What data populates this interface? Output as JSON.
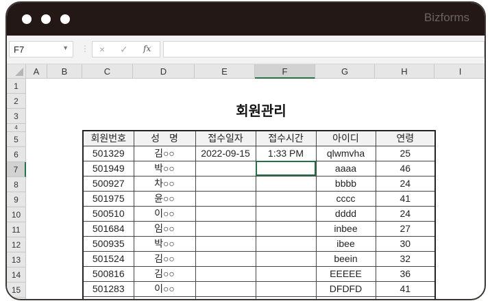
{
  "window": {
    "brand": "Bizforms"
  },
  "toolbar": {
    "name_box": "F7",
    "cancel_icon": "×",
    "enter_icon": "✓",
    "function_icon": "fx",
    "formula": ""
  },
  "columns": [
    "A",
    "B",
    "C",
    "D",
    "E",
    "F",
    "G",
    "H",
    "I"
  ],
  "rows": [
    "1",
    "2",
    "3",
    "4",
    "5",
    "6",
    "7",
    "8",
    "9",
    "10",
    "11",
    "12",
    "13",
    "14",
    "15"
  ],
  "sheet": {
    "title": "회원관리",
    "headers": [
      "회원번호",
      "성　명",
      "접수일자",
      "접수시간",
      "아이디",
      "연령"
    ],
    "records": [
      [
        "501329",
        "김○○",
        "2022-09-15",
        "1:33 PM",
        "qlwmvha",
        "25"
      ],
      [
        "501949",
        "박○○",
        "",
        "",
        "aaaa",
        "46"
      ],
      [
        "500927",
        "차○○",
        "",
        "",
        "bbbb",
        "24"
      ],
      [
        "501975",
        "윤○○",
        "",
        "",
        "cccc",
        "41"
      ],
      [
        "500510",
        "이○○",
        "",
        "",
        "dddd",
        "24"
      ],
      [
        "501684",
        "임○○",
        "",
        "",
        "inbee",
        "27"
      ],
      [
        "500935",
        "박○○",
        "",
        "",
        "ibee",
        "30"
      ],
      [
        "501524",
        "김○○",
        "",
        "",
        "beein",
        "32"
      ],
      [
        "500816",
        "김○○",
        "",
        "",
        "EEEEE",
        "36"
      ],
      [
        "501283",
        "이○○",
        "",
        "",
        "DFDFD",
        "41"
      ]
    ]
  }
}
